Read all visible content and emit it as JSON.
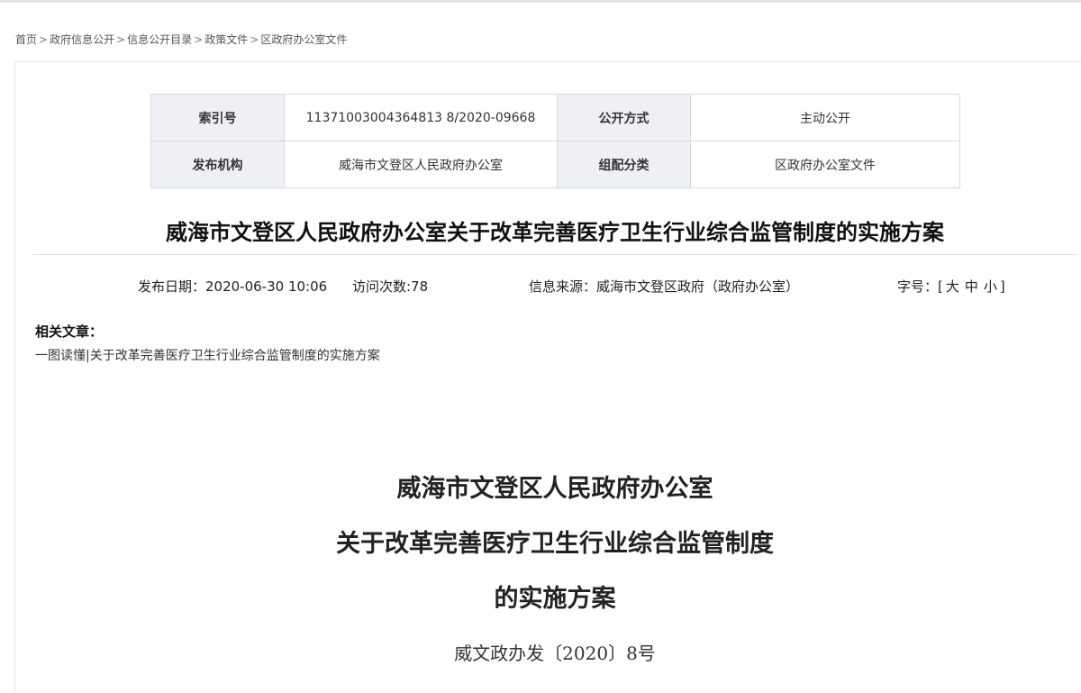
{
  "breadcrumb": {
    "items": [
      "首页",
      "政府信息公开",
      "信息公开目录",
      "政策文件",
      "区政府办公室文件"
    ],
    "separator": ">"
  },
  "meta_table": {
    "index_key": "索引号",
    "index_value": "11371003004364813 8/2020-09668",
    "disclosure_key": "公开方式",
    "disclosure_value": "主动公开",
    "publisher_key": "发布机构",
    "publisher_value": "威海市文登区人民政府办公室",
    "category_key": "组配分类",
    "category_value": "区政府办公室文件"
  },
  "article": {
    "title": "威海市文登区人民政府办公室关于改革完善医疗卫生行业综合监管制度的实施方案",
    "publish_date": "发布日期：2020-06-30 10:06",
    "visits": "访问次数:78",
    "source": "信息来源：威海市文登区政府（政府办公室）",
    "font_size_label": "字号：[",
    "font_size_options": [
      "大",
      "中",
      "小"
    ],
    "font_size_close": "]"
  },
  "related": {
    "label": "相关文章：",
    "link": "一图读懂|关于改革完善医疗卫生行业综合监管制度的实施方案"
  },
  "document": {
    "heading_line1": "威海市文登区人民政府办公室",
    "heading_line2": "关于改革完善医疗卫生行业综合监管制度",
    "heading_line3": "的实施方案",
    "doc_number": "威文政办发〔2020〕8号"
  },
  "colors": {
    "table_key_bg": "#eef0f5",
    "border": "#d9d9d9",
    "title_text": "#111111"
  }
}
